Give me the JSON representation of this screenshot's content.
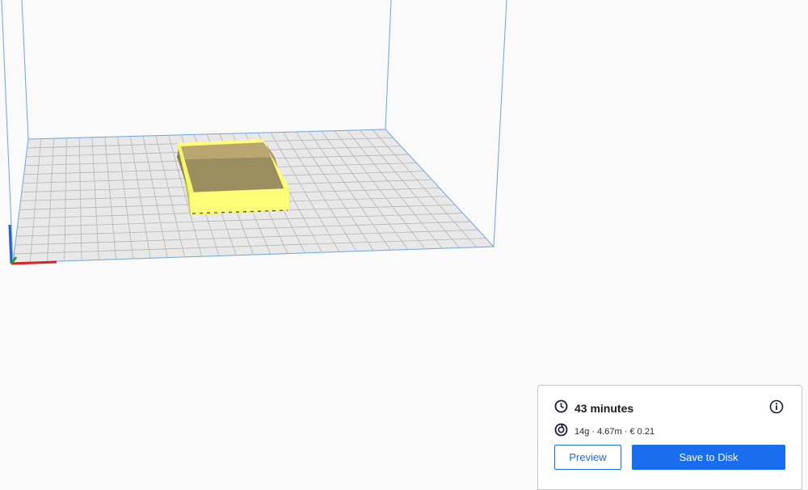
{
  "viewport": {
    "model_color": "#ffff77",
    "plate_color": "#e8e8e8",
    "volume_line_color": "#6ea4dc",
    "axis_x_color": "#e02020",
    "axis_y_color": "#2060e0",
    "axis_z_color": "#20a020"
  },
  "print_panel": {
    "time_icon": "clock-icon",
    "print_time": "43 minutes",
    "info_icon": "info-icon",
    "material_icon": "spool-icon",
    "material_summary": "14g · 4.67m · € 0.21",
    "preview_label": "Preview",
    "save_label": "Save to Disk",
    "accent_color": "#196ef0"
  }
}
